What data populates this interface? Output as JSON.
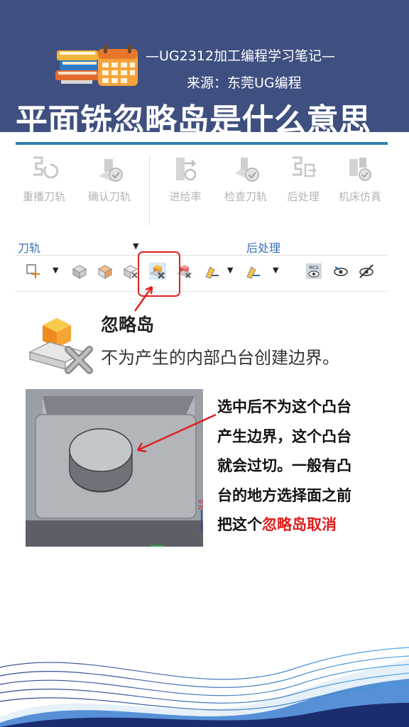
{
  "header": {
    "subtitle": "—UG2312加工编程学习笔记—",
    "source": "来源：东莞UG编程",
    "title": "平面铣忽略岛是什么意思"
  },
  "ribbon": {
    "buttons": [
      {
        "label": "重播刀轨",
        "icon": "replay-toolpath-icon"
      },
      {
        "label": "确认刀轨",
        "icon": "verify-toolpath-icon"
      },
      {
        "label": "进给率",
        "icon": "feedrate-icon"
      },
      {
        "label": "检查刀轨",
        "icon": "check-toolpath-icon"
      },
      {
        "label": "后处理",
        "icon": "postprocess-icon"
      },
      {
        "label": "机床仿真",
        "icon": "machine-simulation-icon"
      }
    ],
    "groups": {
      "left": "刀轨",
      "right": "后处理"
    },
    "mcs_label": "MCS"
  },
  "tooltip": {
    "title": "忽略岛",
    "description": "不为产生的内部凸台创建边界。"
  },
  "part": {
    "axis_labels": [
      "XM",
      "ZM"
    ]
  },
  "note": {
    "line1": "选中后不为这个凸台",
    "line2": "产生边界，这个凸台",
    "line3": "就会过切。一般有凸",
    "line4": "台的地方选择面之前",
    "line5_prefix": "把这个",
    "line5_highlight": "忽略岛取消"
  },
  "colors": {
    "header_bg": "#3f5080",
    "accent_blue": "#2f7fa9",
    "highlight_red": "#e02020",
    "text_red": "#e11b1b"
  }
}
